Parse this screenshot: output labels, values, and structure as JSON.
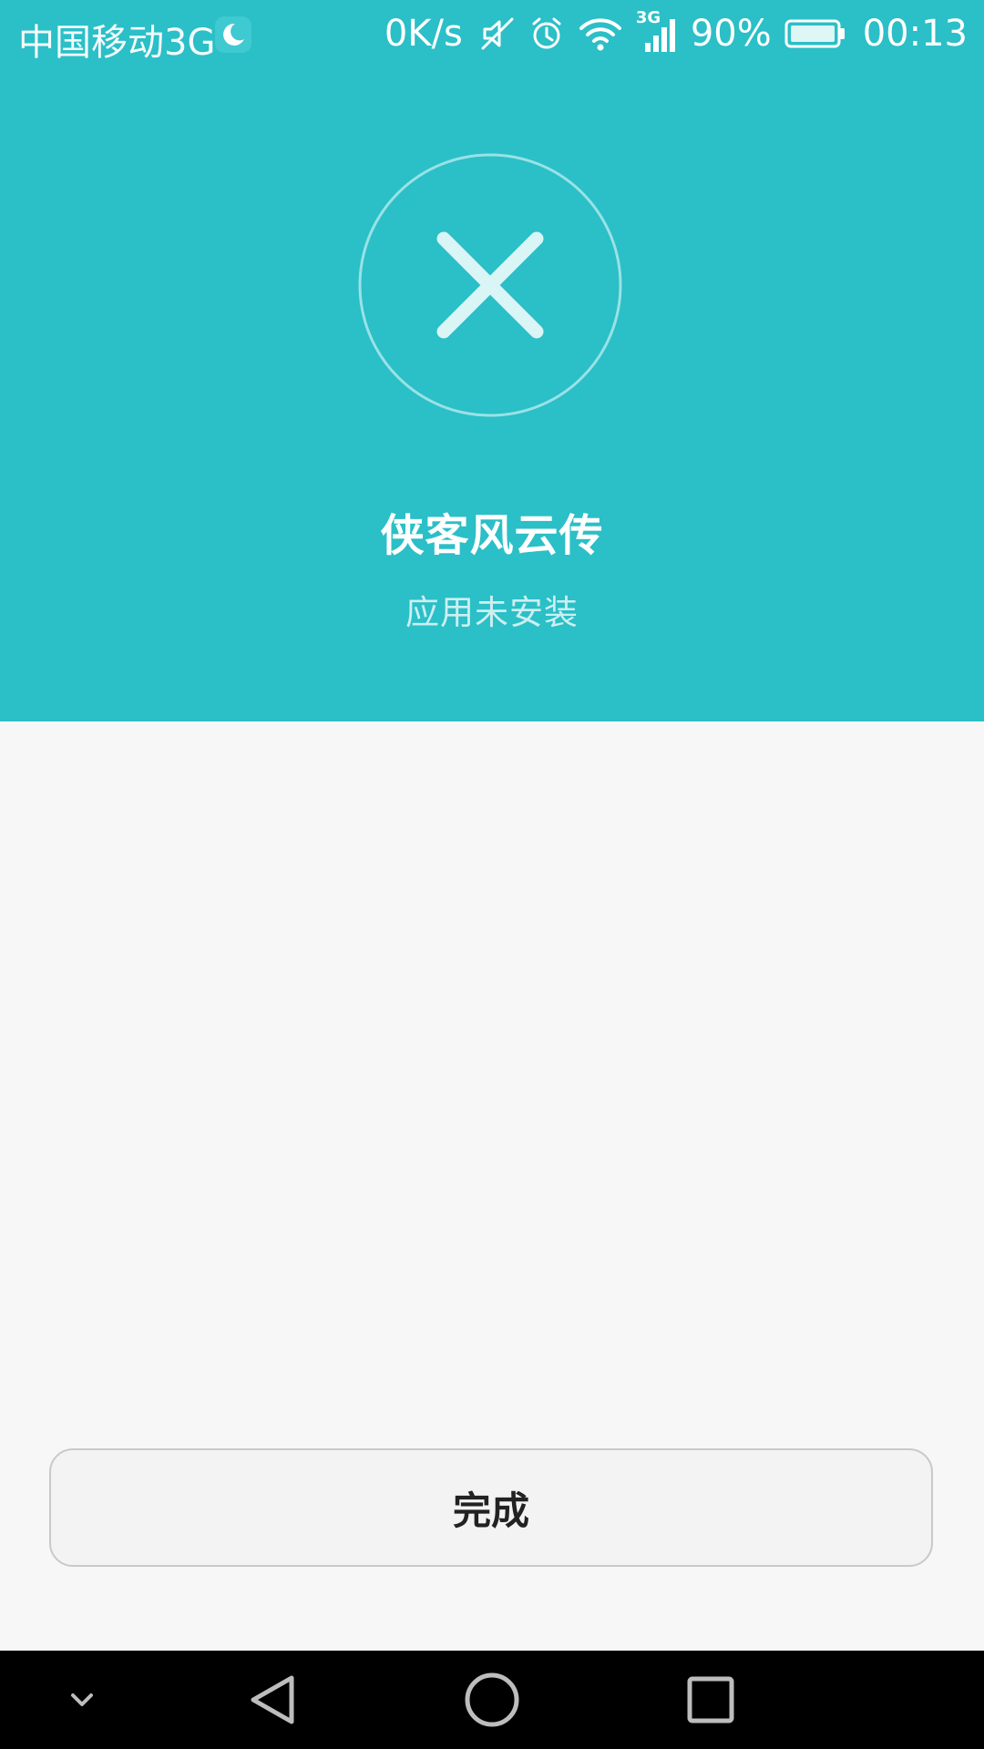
{
  "status_bar": {
    "carrier": "中国移动3G",
    "net_speed": "0K/s",
    "signal_type": "3G",
    "battery": "90%",
    "time": "00:13"
  },
  "result": {
    "icon": "close-x-icon",
    "app_name": "侠客风云传",
    "message": "应用未安装"
  },
  "actions": {
    "done_label": "完成"
  },
  "nav_bar": {
    "items": [
      "collapse-chevron-icon",
      "back-triangle-icon",
      "home-circle-icon",
      "recents-square-icon"
    ]
  },
  "colors": {
    "header_bg": "#2bbfc7",
    "body_bg": "#f7f7f7",
    "nav_bg": "#000000"
  }
}
